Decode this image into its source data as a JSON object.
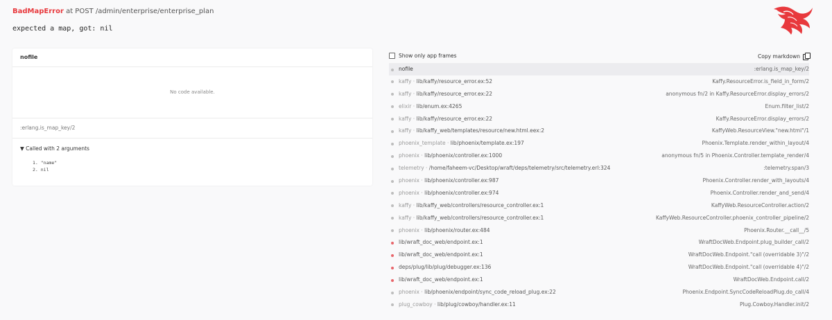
{
  "header": {
    "error_type": "BadMapError",
    "request_info": " at POST /admin/enterprise/enterprise_plan",
    "message": "expected a map, got: nil"
  },
  "colors": {
    "error_red": "#e8393d",
    "app_frame_dot": "#e8656a",
    "lib_frame_dot": "#bdbdbd",
    "logo_red": "#e8393d"
  },
  "logo": {
    "icon": "phoenix-logo-icon"
  },
  "code_panel": {
    "file": "nofile",
    "no_code": "No code available.",
    "mfa": ":erlang.is_map_key/2",
    "called_with": "▼ Called with 2 arguments",
    "args": [
      "1. \"name\"",
      "2. nil"
    ]
  },
  "toolbar": {
    "show_app_frames_label": "Show only app frames",
    "copy_markdown_label": "Copy markdown"
  },
  "frames": [
    {
      "app": "",
      "sep": "",
      "file": "nofile",
      "func": ":erlang.is_map_key/2",
      "is_app": false,
      "active": true
    },
    {
      "app": "kaffy",
      "sep": " · ",
      "file": "lib/kaffy/resource_error.ex:52",
      "func": "Kaffy.ResourceError.is_field_in_form/2",
      "is_app": false,
      "active": false
    },
    {
      "app": "kaffy",
      "sep": " · ",
      "file": "lib/kaffy/resource_error.ex:22",
      "func": "anonymous fn/2 in Kaffy.ResourceError.display_errors/2",
      "is_app": false,
      "active": false
    },
    {
      "app": "elixir",
      "sep": " · ",
      "file": "lib/enum.ex:4265",
      "func": "Enum.filter_list/2",
      "is_app": false,
      "active": false
    },
    {
      "app": "kaffy",
      "sep": " · ",
      "file": "lib/kaffy/resource_error.ex:22",
      "func": "Kaffy.ResourceError.display_errors/2",
      "is_app": false,
      "active": false
    },
    {
      "app": "kaffy",
      "sep": " · ",
      "file": "lib/kaffy_web/templates/resource/new.html.eex:2",
      "func": "KaffyWeb.ResourceView.\"new.html\"/1",
      "is_app": false,
      "active": false
    },
    {
      "app": "phoenix_template",
      "sep": " · ",
      "file": "lib/phoenix/template.ex:197",
      "func": "Phoenix.Template.render_within_layout/4",
      "is_app": false,
      "active": false
    },
    {
      "app": "phoenix",
      "sep": " · ",
      "file": "lib/phoenix/controller.ex:1000",
      "func": "anonymous fn/5 in Phoenix.Controller.template_render/4",
      "is_app": false,
      "active": false
    },
    {
      "app": "telemetry",
      "sep": " · ",
      "file": "/home/faheem-vc/Desktop/wraft/deps/telemetry/src/telemetry.erl:324",
      "func": ":telemetry.span/3",
      "is_app": false,
      "active": false
    },
    {
      "app": "phoenix",
      "sep": " · ",
      "file": "lib/phoenix/controller.ex:987",
      "func": "Phoenix.Controller.render_with_layouts/4",
      "is_app": false,
      "active": false
    },
    {
      "app": "phoenix",
      "sep": " · ",
      "file": "lib/phoenix/controller.ex:974",
      "func": "Phoenix.Controller.render_and_send/4",
      "is_app": false,
      "active": false
    },
    {
      "app": "kaffy",
      "sep": " · ",
      "file": "lib/kaffy_web/controllers/resource_controller.ex:1",
      "func": "KaffyWeb.ResourceController.action/2",
      "is_app": false,
      "active": false
    },
    {
      "app": "kaffy",
      "sep": " · ",
      "file": "lib/kaffy_web/controllers/resource_controller.ex:1",
      "func": "KaffyWeb.ResourceController.phoenix_controller_pipeline/2",
      "is_app": false,
      "active": false
    },
    {
      "app": "phoenix",
      "sep": " · ",
      "file": "lib/phoenix/router.ex:484",
      "func": "Phoenix.Router.__call__/5",
      "is_app": false,
      "active": false
    },
    {
      "app": "",
      "sep": "",
      "file": "lib/wraft_doc_web/endpoint.ex:1",
      "func": "WraftDocWeb.Endpoint.plug_builder_call/2",
      "is_app": true,
      "active": false
    },
    {
      "app": "",
      "sep": "",
      "file": "lib/wraft_doc_web/endpoint.ex:1",
      "func": "WraftDocWeb.Endpoint.\"call (overridable 3)\"/2",
      "is_app": true,
      "active": false
    },
    {
      "app": "",
      "sep": "",
      "file": "deps/plug/lib/plug/debugger.ex:136",
      "func": "WraftDocWeb.Endpoint.\"call (overridable 4)\"/2",
      "is_app": true,
      "active": false
    },
    {
      "app": "",
      "sep": "",
      "file": "lib/wraft_doc_web/endpoint.ex:1",
      "func": "WraftDocWeb.Endpoint.call/2",
      "is_app": true,
      "active": false
    },
    {
      "app": "phoenix",
      "sep": " · ",
      "file": "lib/phoenix/endpoint/sync_code_reload_plug.ex:22",
      "func": "Phoenix.Endpoint.SyncCodeReloadPlug.do_call/4",
      "is_app": false,
      "active": false
    },
    {
      "app": "plug_cowboy",
      "sep": " · ",
      "file": "lib/plug/cowboy/handler.ex:11",
      "func": "Plug.Cowboy.Handler.init/2",
      "is_app": false,
      "active": false
    }
  ]
}
